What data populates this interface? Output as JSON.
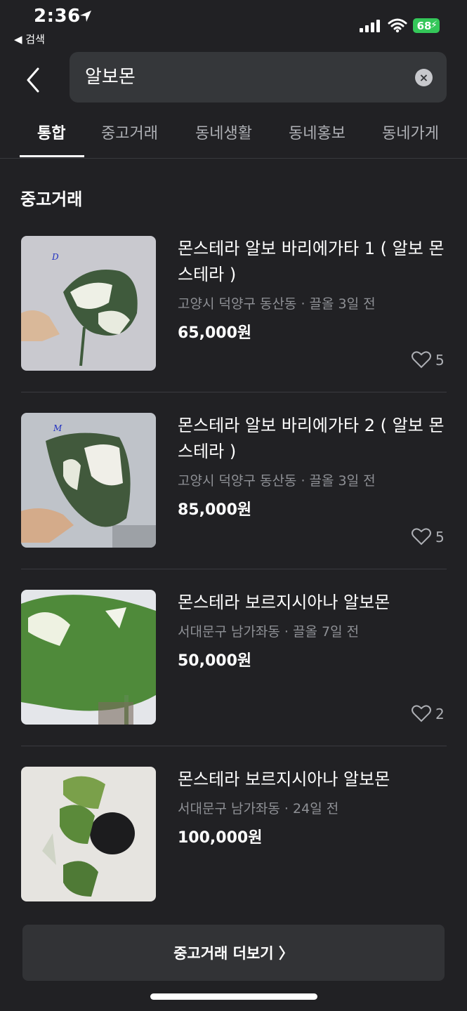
{
  "status_bar": {
    "time": "2:36",
    "back_app": "◀ 검색",
    "battery": "68"
  },
  "search": {
    "query": "알보몬",
    "clear_icon": "×"
  },
  "tabs": [
    {
      "label": "통합",
      "active": true
    },
    {
      "label": "중고거래"
    },
    {
      "label": "동네생활"
    },
    {
      "label": "동네홍보"
    },
    {
      "label": "동네가게"
    }
  ],
  "section": {
    "title": "중고거래",
    "items": [
      {
        "title": "몬스테라 알보 바리에가타 1 ( 알보 몬스테라 )",
        "location": "고양시 덕양구 동산동",
        "time": "끌올 3일 전",
        "price": "65,000원",
        "likes": "5",
        "photo_mark": "D"
      },
      {
        "title": "몬스테라 알보 바리에가타 2 ( 알보 몬스테라 )",
        "location": "고양시 덕양구 동산동",
        "time": "끌올 3일 전",
        "price": "85,000원",
        "likes": "5",
        "photo_mark": "M"
      },
      {
        "title": "몬스테라 보르지시아나 알보몬",
        "location": "서대문구 남가좌동",
        "time": "끌올 7일 전",
        "price": "50,000원",
        "likes": "2"
      },
      {
        "title": "몬스테라 보르지시아나 알보몬",
        "location": "서대문구 남가좌동",
        "time": "24일 전",
        "price": "100,000원"
      }
    ],
    "more_label": "중고거래 더보기 〉"
  }
}
